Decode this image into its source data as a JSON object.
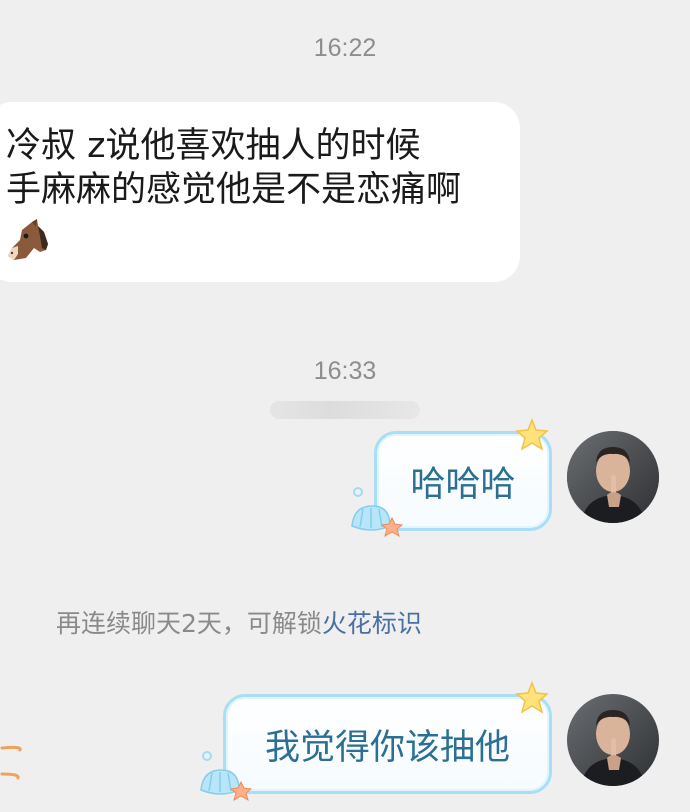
{
  "chat": {
    "timestamp_1": "16:22",
    "incoming_message": {
      "line_1": "冷叔  z说他喜欢抽人的时候",
      "line_2": "手麻麻的感觉他是不是恋痛啊",
      "emoji": "horse-face-emoji"
    },
    "timestamp_2": "16:33",
    "outgoing_message_1": "哈哈哈",
    "notice": {
      "prefix": "再连续聊天2天，可解锁",
      "highlight": "火花标识"
    },
    "outgoing_message_2": "我觉得你该抽他"
  },
  "colors": {
    "background": "#efefef",
    "incoming_bubble": "#ffffff",
    "outgoing_bubble_border": "#a8def6",
    "outgoing_text": "#2b6f93",
    "highlight_text": "#4a6fa5",
    "timestamp_text": "#8d8d8d"
  }
}
